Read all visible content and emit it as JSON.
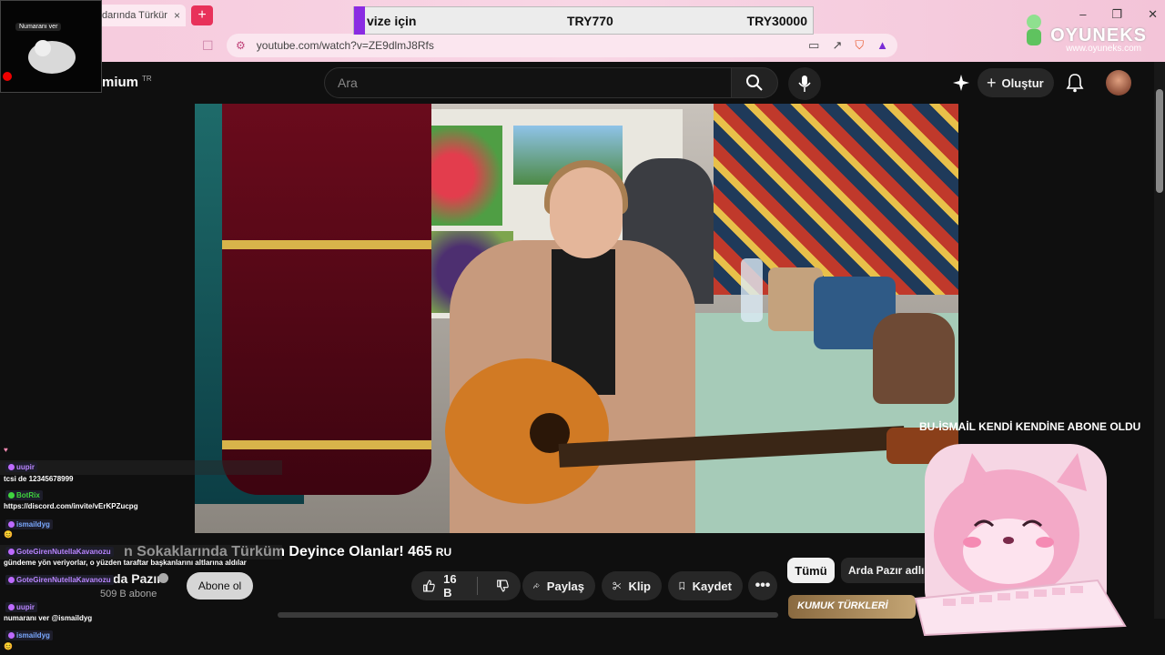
{
  "browser": {
    "tab_title": "darında Türkür",
    "tab_close": "×",
    "new_tab": "+",
    "url": "youtube.com/watch?v=ZE9dlmJ8Rfs",
    "window_controls": [
      "–",
      "❐",
      "✕"
    ]
  },
  "price_overlay": {
    "label": "vize için",
    "price1": "TRY770",
    "price2": "TRY30000",
    "accent": "#8a2be2"
  },
  "logo": {
    "name": "OYUNEKS",
    "site": "www.oyuneks.com"
  },
  "webcam": {
    "label": "Numaranı ver"
  },
  "youtube": {
    "logo_text": "mium",
    "region": "TR",
    "search_placeholder": "Ara",
    "create_label": "Oluştur"
  },
  "video": {
    "title": "n Sokaklarında Türküm Deyince Olanlar! 465",
    "title_suffix": "RU",
    "channel": "da Pazır",
    "subscribers": "509 B abone",
    "subscribe_label": "Abone ol",
    "likes": "16 B",
    "share_label": "Paylaş",
    "clip_label": "Klip",
    "save_label": "Kaydet"
  },
  "sidebar_chips": {
    "all": "Tümü",
    "channel_uploads": "Arda Pazır adlı yükleyi"
  },
  "related": {
    "thumb_text": "KUMUK TÜRKLERİ"
  },
  "notification": "BU-İSMAİL KENDİ KENDİNE ABONE OLDU",
  "chat": [
    {
      "user": "uupir",
      "message": "tcsi de 12345678999",
      "color": "purple"
    },
    {
      "user": "BotRix",
      "message": "https://discord.com/invite/vErKPZucpg",
      "color": "green"
    },
    {
      "user": "ismaildyg",
      "message": "😊",
      "color": "blue"
    },
    {
      "user": "GoteGirenNutellaKavanozu",
      "message": "gündeme yön veriyorlar, o yüzden taraftar başkanlarını altlarına aldılar",
      "color": "purple"
    },
    {
      "user": "GoteGirenNutellaKavanozu",
      "message": "",
      "color": "purple"
    },
    {
      "user": "uupir",
      "message": "numaranı ver @ismaildyg",
      "color": "purple"
    },
    {
      "user": "ismaildyg",
      "message": "😊",
      "color": "blue"
    }
  ]
}
